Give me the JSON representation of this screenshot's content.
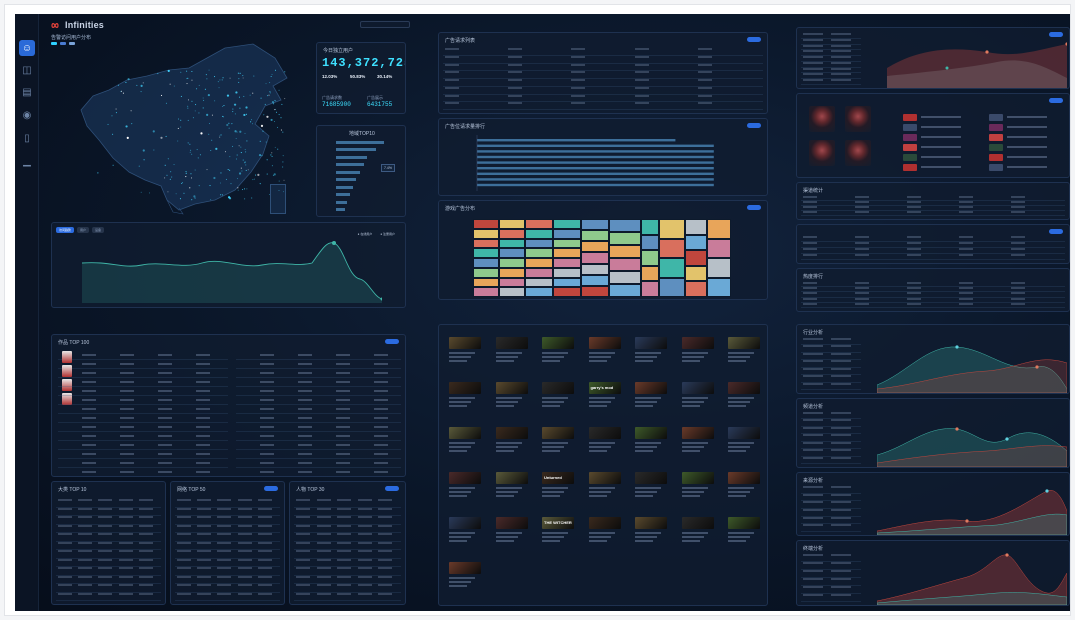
{
  "app": {
    "name": "Infinities"
  },
  "sidebar": {
    "items": [
      {
        "icon": "user-icon",
        "active": true
      },
      {
        "icon": "database-icon",
        "active": false
      },
      {
        "icon": "document-icon",
        "active": false
      },
      {
        "icon": "gamepad-icon",
        "active": false
      },
      {
        "icon": "device-icon",
        "active": false
      },
      {
        "icon": "chart-icon",
        "active": false
      }
    ]
  },
  "map": {
    "title": "告警访问用户分布",
    "legend_colors": [
      "#2fd1ff",
      "#4a7bd1",
      "#7aa3d8"
    ]
  },
  "stats": {
    "title": "今日独立用户",
    "total": "143,372,725",
    "metrics": [
      "12.03%",
      "50.83%",
      "30.14%"
    ],
    "sub": [
      {
        "label": "广告请求数",
        "value": "71685900"
      },
      {
        "label": "广告展示",
        "value": "6431755"
      }
    ],
    "rank_title": "地域TOP10",
    "rank_badge": "7.4%",
    "rank_values": [
      0.95,
      0.8,
      0.62,
      0.55,
      0.48,
      0.4,
      0.34,
      0.28,
      0.22,
      0.18
    ]
  },
  "trend": {
    "tabs": [
      "访问趋势",
      "用户",
      "设备"
    ],
    "legend": [
      "在线用户",
      "注册用户"
    ]
  },
  "panels": {
    "ad_requests": "广告请求列表",
    "ad_bar": "广告位请求量排行",
    "ad_treemap": "游戏广告分布",
    "works_top": "作品 TOP 100",
    "top_a": "大类 TOP 10",
    "top_b": "网络 TOP 50",
    "top_c": "人物 TOP 30",
    "right_c": "热度排行",
    "right_d": "热门推荐",
    "right_e": "渠道统计",
    "chart_1": "行业分析",
    "chart_2": "频道分析",
    "chart_3": "来源分析",
    "chart_4": "终端分析"
  },
  "games": [
    "Unturned",
    "garry's mod",
    "Fallout",
    "THE WITCHER",
    "SAINTS ROW"
  ],
  "colors": {
    "accent": "#2b6be0",
    "cyan": "#3ee0ff",
    "teal": "#3fb6a8",
    "red": "#c0463d"
  }
}
